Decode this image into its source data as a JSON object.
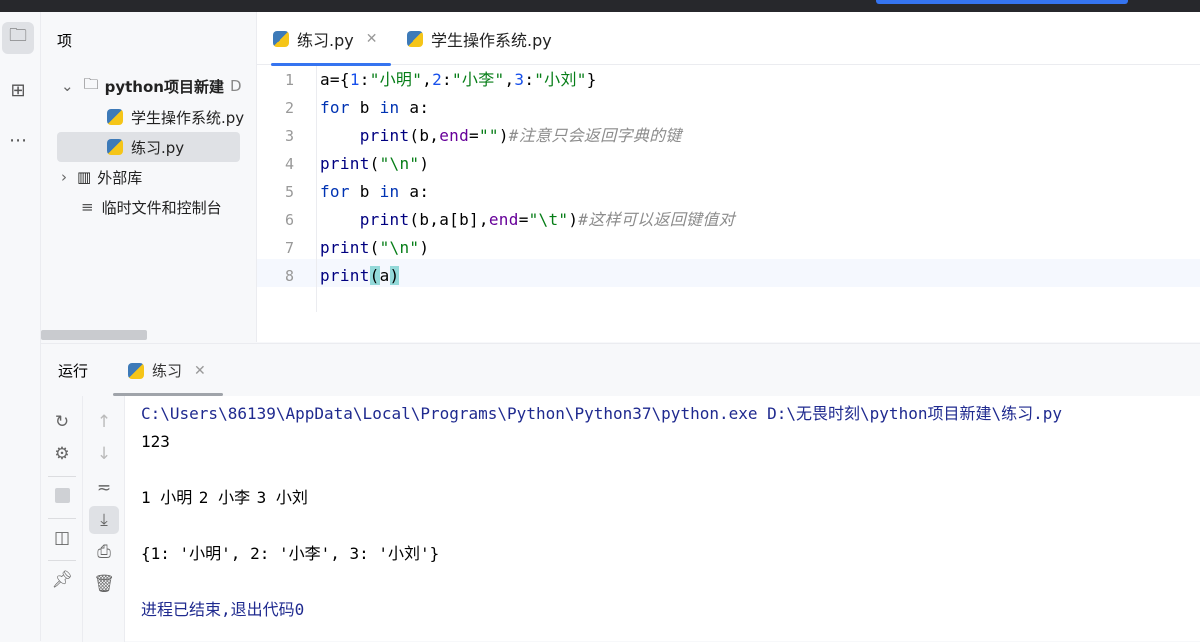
{
  "project_panel": {
    "title": "项",
    "tree": [
      {
        "label": "python项目新建",
        "suffix": "D",
        "type": "folder",
        "expanded": true
      },
      {
        "label": "学生操作系统.py",
        "type": "python-file"
      },
      {
        "label": "练习.py",
        "type": "python-file",
        "selected": true
      },
      {
        "label": "外部库",
        "type": "library",
        "expanded": false
      },
      {
        "label": "临时文件和控制台",
        "type": "scratches"
      }
    ]
  },
  "editor": {
    "tabs": [
      {
        "label": "练习.py",
        "active": true,
        "closable": true
      },
      {
        "label": "学生操作系统.py",
        "active": false
      }
    ],
    "lines": [
      [
        [
          "plain",
          "a={"
        ],
        [
          "num",
          "1"
        ],
        [
          "plain",
          ":"
        ],
        [
          "str",
          "\"小明\""
        ],
        [
          "plain",
          ","
        ],
        [
          "num",
          "2"
        ],
        [
          "plain",
          ":"
        ],
        [
          "str",
          "\"小李\""
        ],
        [
          "plain",
          ","
        ],
        [
          "num",
          "3"
        ],
        [
          "plain",
          ":"
        ],
        [
          "str",
          "\"小刘\""
        ],
        [
          "plain",
          "}"
        ]
      ],
      [
        [
          "kw",
          "for"
        ],
        [
          "plain",
          " b "
        ],
        [
          "kw",
          "in"
        ],
        [
          "plain",
          " a:"
        ]
      ],
      [
        [
          "plain",
          "    "
        ],
        [
          "fn",
          "print"
        ],
        [
          "plain",
          "(b,"
        ],
        [
          "arg",
          "end"
        ],
        [
          "plain",
          "="
        ],
        [
          "str",
          "\"\""
        ],
        [
          "plain",
          ")"
        ],
        [
          "cm",
          "#注意只会返回字典的键"
        ]
      ],
      [
        [
          "fn",
          "print"
        ],
        [
          "plain",
          "("
        ],
        [
          "str",
          "\"\\n\""
        ],
        [
          "plain",
          ")"
        ]
      ],
      [
        [
          "kw",
          "for"
        ],
        [
          "plain",
          " b "
        ],
        [
          "kw",
          "in"
        ],
        [
          "plain",
          " a:"
        ]
      ],
      [
        [
          "plain",
          "    "
        ],
        [
          "fn",
          "print"
        ],
        [
          "plain",
          "(b,a[b],"
        ],
        [
          "arg",
          "end"
        ],
        [
          "plain",
          "="
        ],
        [
          "str",
          "\"\\t\""
        ],
        [
          "plain",
          ")"
        ],
        [
          "cm",
          "#这样可以返回键值对"
        ]
      ],
      [
        [
          "fn",
          "print"
        ],
        [
          "plain",
          "("
        ],
        [
          "str",
          "\"\\n\""
        ],
        [
          "plain",
          ")"
        ]
      ],
      [
        [
          "fn",
          "print"
        ],
        [
          "br",
          "("
        ],
        [
          "plain",
          "a"
        ],
        [
          "br",
          ")"
        ]
      ]
    ]
  },
  "run_panel": {
    "label": "运行",
    "tab": "练习",
    "output": [
      "C:\\Users\\86139\\AppData\\Local\\Programs\\Python\\Python37\\python.exe D:\\无畏时刻\\python项目新建\\练习.py",
      "123",
      "",
      "1 小明\t2 小李\t3 小刘",
      "",
      "{1: '小明', 2: '小李', 3: '小刘'}",
      "",
      "进程已结束,退出代码0"
    ]
  },
  "colors": {
    "accent": "#3574f0",
    "keyword": "#0033b3",
    "string": "#067d17",
    "number": "#1750eb",
    "comment": "#8c8c8c"
  }
}
